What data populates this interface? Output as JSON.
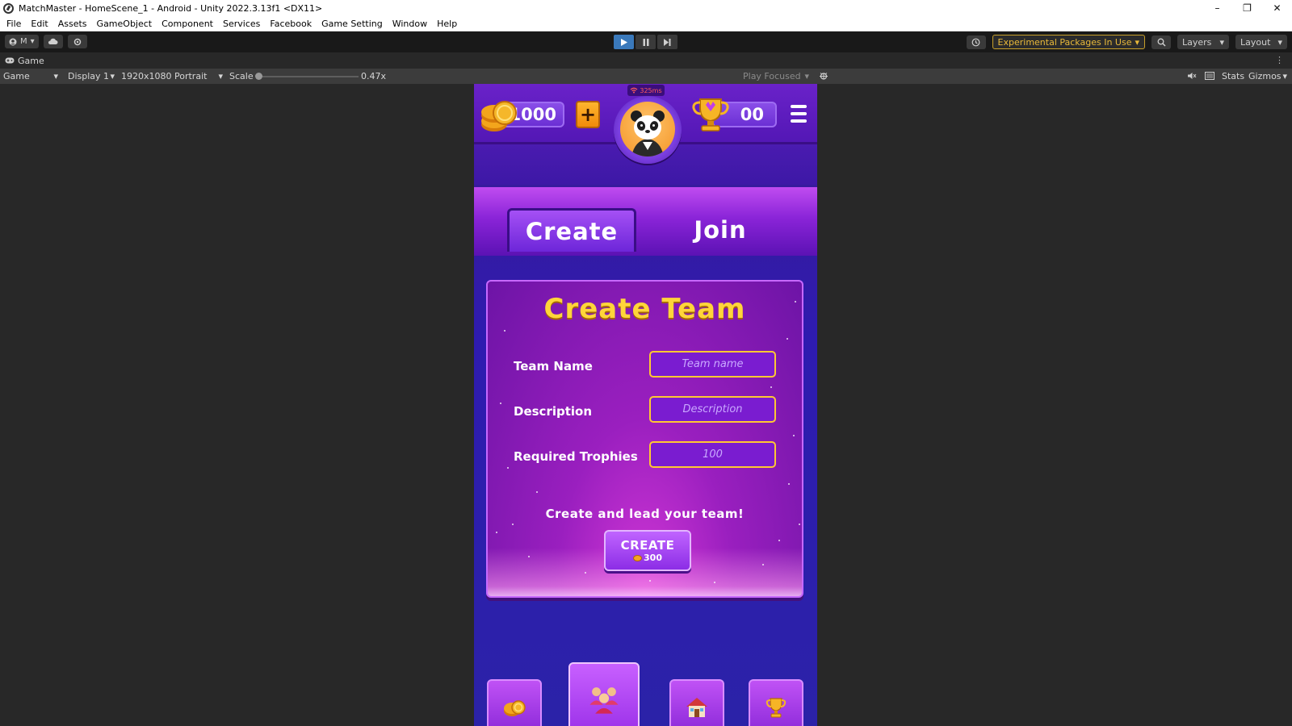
{
  "window": {
    "title": "MatchMaster - HomeScene_1 - Android - Unity 2022.3.13f1 <DX11>",
    "controls": [
      "–",
      "❐",
      "✕"
    ]
  },
  "menu": [
    "File",
    "Edit",
    "Assets",
    "GameObject",
    "Component",
    "Services",
    "Facebook",
    "Game Setting",
    "Window",
    "Help"
  ],
  "toolbar": {
    "account_label": "M",
    "experimental_label": "Experimental Packages In Use",
    "layers_label": "Layers",
    "layout_label": "Layout"
  },
  "game_view": {
    "tab_label": "Game",
    "mode_select": "Game",
    "display_select": "Display 1",
    "resolution_select": "1920x1080 Portrait",
    "scale_label": "Scale",
    "scale_value": "0.47x",
    "play_mode_select": "Play Focused",
    "stats_label": "Stats",
    "gizmos_label": "Gizmos"
  },
  "hud": {
    "ping": "325ms",
    "coins": "1000",
    "plus": "+",
    "trophies": "00"
  },
  "tabs": {
    "create": "Create",
    "join": "Join",
    "active": "create"
  },
  "panel": {
    "title": "Create Team",
    "fields": [
      {
        "label": "Team Name",
        "placeholder": "Team name",
        "value": ""
      },
      {
        "label": "Description",
        "placeholder": "Description",
        "value": ""
      },
      {
        "label": "Required Trophies",
        "placeholder": "100",
        "value": ""
      }
    ],
    "tagline": "Create and lead your team!",
    "create_button": {
      "label": "CREATE",
      "cost": "300"
    }
  },
  "bottom_nav": [
    {
      "icon": "coins-icon",
      "active": false
    },
    {
      "icon": "team-icon",
      "active": true
    },
    {
      "icon": "home-icon",
      "active": false
    },
    {
      "icon": "trophy-icon",
      "active": false
    }
  ],
  "colors": {
    "accent_gold": "#ffd53a",
    "input_border": "#ffc832",
    "header_purple": "#6a22c9",
    "panel_purple": "#9a1fbf",
    "play_active": "#3a79bb",
    "experimental_text": "#e9b93a"
  }
}
